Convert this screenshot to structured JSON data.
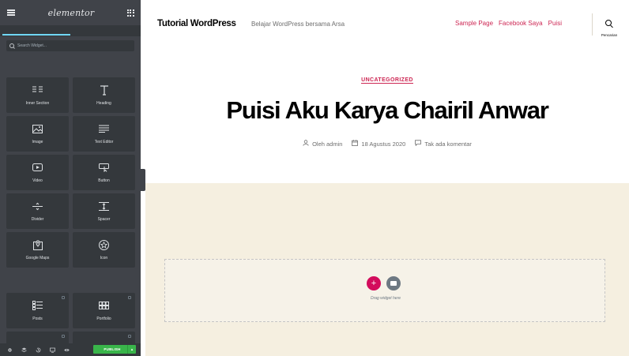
{
  "panel": {
    "brand": "elementor",
    "search": {
      "placeholder": "Search Widget..."
    },
    "widgets_basic": [
      {
        "label": "Inner Section",
        "icon": "inner-section-icon"
      },
      {
        "label": "Heading",
        "icon": "heading-icon"
      },
      {
        "label": "Image",
        "icon": "image-icon"
      },
      {
        "label": "Text Editor",
        "icon": "text-editor-icon"
      },
      {
        "label": "Video",
        "icon": "video-icon"
      },
      {
        "label": "Button",
        "icon": "button-icon"
      },
      {
        "label": "Divider",
        "icon": "divider-icon"
      },
      {
        "label": "Spacer",
        "icon": "spacer-icon"
      },
      {
        "label": "Google Maps",
        "icon": "map-icon"
      },
      {
        "label": "Icon",
        "icon": "star-icon"
      }
    ],
    "widgets_pro": [
      {
        "label": "Posts",
        "icon": "posts-icon"
      },
      {
        "label": "Portfolio",
        "icon": "portfolio-icon"
      }
    ],
    "footer": {
      "publish_label": "PUBLISH",
      "publish_color": "#39b54a"
    }
  },
  "site": {
    "title": "Tutorial WordPress",
    "tagline": "Belajar WordPress bersama Arsa",
    "nav": [
      "Sample Page",
      "Facebook Saya",
      "Puisi"
    ],
    "search_label": "Pencarian",
    "accent": "#cd2653"
  },
  "post": {
    "category": "UNCATEGORIZED",
    "title": "Puisi Aku Karya Chairil Anwar",
    "author": "Oleh admin",
    "date": "18 Agustus 2020",
    "comments": "Tak ada komentar"
  },
  "editor": {
    "drop_text": "Drag widget here",
    "add_color": "#d30c5c"
  }
}
